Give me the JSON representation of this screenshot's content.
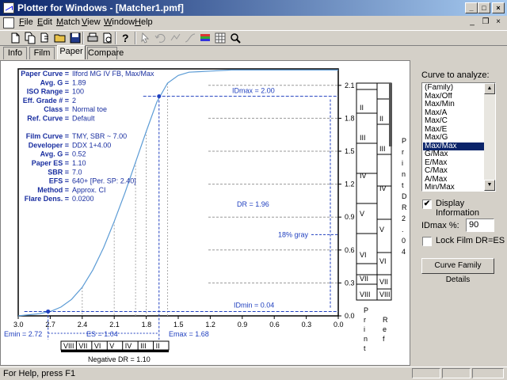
{
  "window": {
    "title": "Plotter for Windows - [Matcher1.pmf]"
  },
  "menu": {
    "items": [
      {
        "hot": "F",
        "rest": "ile"
      },
      {
        "hot": "E",
        "rest": "dit"
      },
      {
        "hot": "M",
        "rest": "atch"
      },
      {
        "hot": "V",
        "rest": "iew"
      },
      {
        "hot": "W",
        "rest": "indow"
      },
      {
        "hot": "H",
        "rest": "elp"
      }
    ]
  },
  "toolbar": {
    "icons": [
      "new-document-icon",
      "new-copy-icon",
      "open-copy-icon",
      "open-folder-icon",
      "save-icon",
      "print-icon",
      "print-preview-icon",
      "help-icon",
      "pointer-icon",
      "undo-icon",
      "redo-icon",
      "curve-tool-icon",
      "color-palette-icon",
      "grid-icon",
      "zoom-icon"
    ]
  },
  "tabs": [
    "Info",
    "Film",
    "Paper",
    "Compare"
  ],
  "active_tab": "Paper",
  "info_block": [
    {
      "label": "Paper Curve",
      "value": "Ilford MG IV FB, Max/Max"
    },
    {
      "label": "Avg. G",
      "value": "1.89"
    },
    {
      "label": "ISO Range",
      "value": "100"
    },
    {
      "label": "Eff. Grade #",
      "value": "2"
    },
    {
      "label": "Class",
      "value": "Normal toe"
    },
    {
      "label": "Ref. Curve",
      "value": "Default"
    },
    {
      "label": "",
      "value": ""
    },
    {
      "label": "Film Curve",
      "value": "TMY, SBR ~ 7.00"
    },
    {
      "label": "Developer",
      "value": "DDX 1+4.00"
    },
    {
      "label": "Avg. G",
      "value": "0.52"
    },
    {
      "label": "Paper ES",
      "value": "1.10"
    },
    {
      "label": "SBR",
      "value": "7.0"
    },
    {
      "label": "EFS",
      "value": "640+ [Per. SP: 2.40]"
    },
    {
      "label": "Method",
      "value": "Approx. CI"
    },
    {
      "label": "Flare Dens.",
      "value": "0.0200"
    }
  ],
  "chart_data": {
    "type": "line",
    "x_axis": {
      "range": [
        3.0,
        0.0
      ],
      "reversed": true,
      "ticks": [
        "3.0",
        "2.7",
        "2.4",
        "2.1",
        "1.8",
        "1.5",
        "1.2",
        "0.9",
        "0.6",
        "0.3",
        "0.0"
      ]
    },
    "y_axis": {
      "range": [
        0.0,
        2.25
      ],
      "ticks": [
        "0.0",
        "0.3",
        "0.6",
        "0.9",
        "1.2",
        "1.5",
        "1.8",
        "2.1"
      ]
    },
    "series": [
      {
        "x": [
          3.0,
          2.9,
          2.8,
          2.7,
          2.6,
          2.5,
          2.4,
          2.3,
          2.2,
          2.1,
          2.0,
          1.9,
          1.8,
          1.7,
          1.6,
          1.5,
          1.4,
          1.2,
          1.0,
          0.8,
          0.6,
          0.4,
          0.2,
          0.0
        ],
        "y": [
          0.0,
          0.01,
          0.02,
          0.04,
          0.08,
          0.15,
          0.26,
          0.42,
          0.62,
          0.86,
          1.12,
          1.4,
          1.68,
          1.95,
          2.12,
          2.19,
          2.22,
          2.23,
          2.24,
          2.24,
          2.24,
          2.24,
          2.24,
          2.24
        ]
      }
    ],
    "idmax": {
      "label": "IDmax = 2.00",
      "x": 1.68,
      "y": 2.0
    },
    "idmin": {
      "label": "IDmin = 0.04",
      "x": 2.72,
      "y": 0.04
    },
    "dr_label": "DR = 1.96",
    "gray_label": "18% gray",
    "gray_y": 0.74,
    "bottom_labels": {
      "emin": "Emin = 2.72",
      "es": "ES = 1.04",
      "emax": "Emax = 1.68"
    },
    "zones_print": [
      "II",
      "III",
      "IV",
      "V",
      "VI",
      "VII",
      "VIII"
    ],
    "zones_ref": [
      "II",
      "III",
      "IV",
      "V",
      "VI",
      "VII",
      "VIII"
    ],
    "zones_negative": [
      "VIII",
      "VII",
      "VI",
      "V",
      "IV",
      "III",
      "II"
    ],
    "negative_dr_label": "Negative DR = 1.10",
    "print_axis_title": "Print",
    "ref_axis_title": "Ref",
    "print_dr_title": "Print DR 2.04"
  },
  "right_panel": {
    "curve_label": "Curve to analyze:",
    "curves": [
      "(Family)",
      "Max/Off",
      "Max/Min",
      "Max/A",
      "Max/C",
      "Max/E",
      "Max/G",
      "Max/Max",
      "G/Max",
      "E/Max",
      "C/Max",
      "A/Max",
      "Min/Max"
    ],
    "selected": "Max/Max",
    "display_info_label": "Display Information",
    "display_info_checked": "✔",
    "idmax_label": "IDmax %:",
    "idmax_value": "90",
    "lock_label": "Lock Film DR=ES",
    "lock_checked": "",
    "details_button": "Curve Family Details"
  },
  "status": {
    "text": "For Help, press F1"
  },
  "colors": {
    "curve": "#5b9bd5",
    "marker": "#1f3fbf",
    "selection": "#0a246a",
    "titlebar": "#0a246a"
  }
}
